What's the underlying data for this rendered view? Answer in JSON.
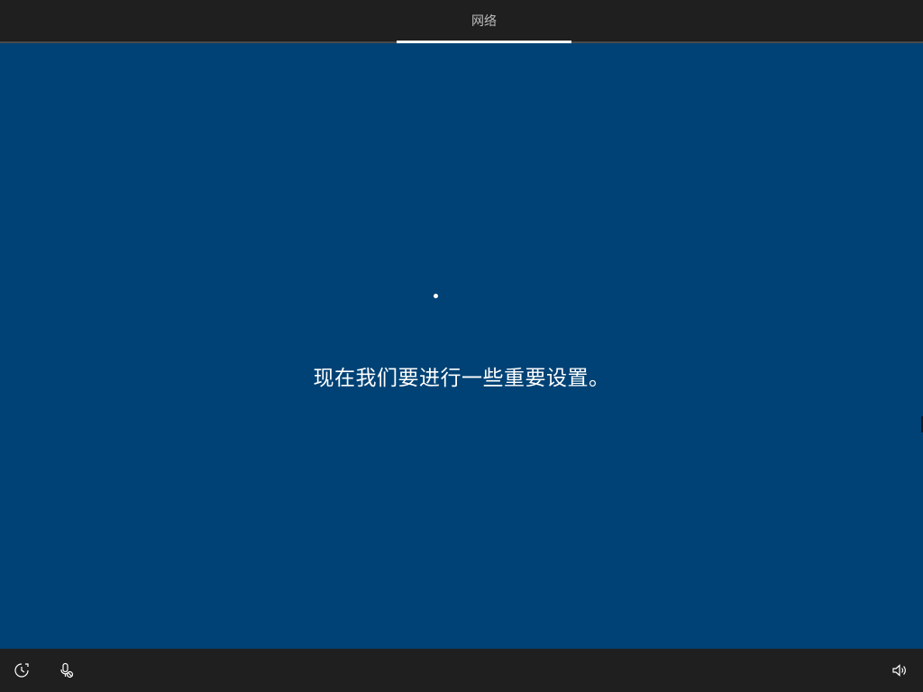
{
  "header": {
    "tabs": [
      {
        "label": "网络",
        "active": true
      }
    ]
  },
  "main": {
    "message": "现在我们要进行一些重要设置。"
  },
  "footer": {
    "left_icons": [
      "ease-of-access-icon",
      "microphone-off-icon"
    ],
    "right_icons": [
      "volume-icon"
    ]
  },
  "colors": {
    "background": "#004275",
    "bars": "#1f1f1f",
    "text": "#ffffff",
    "tab_text": "#bdbdbd"
  }
}
